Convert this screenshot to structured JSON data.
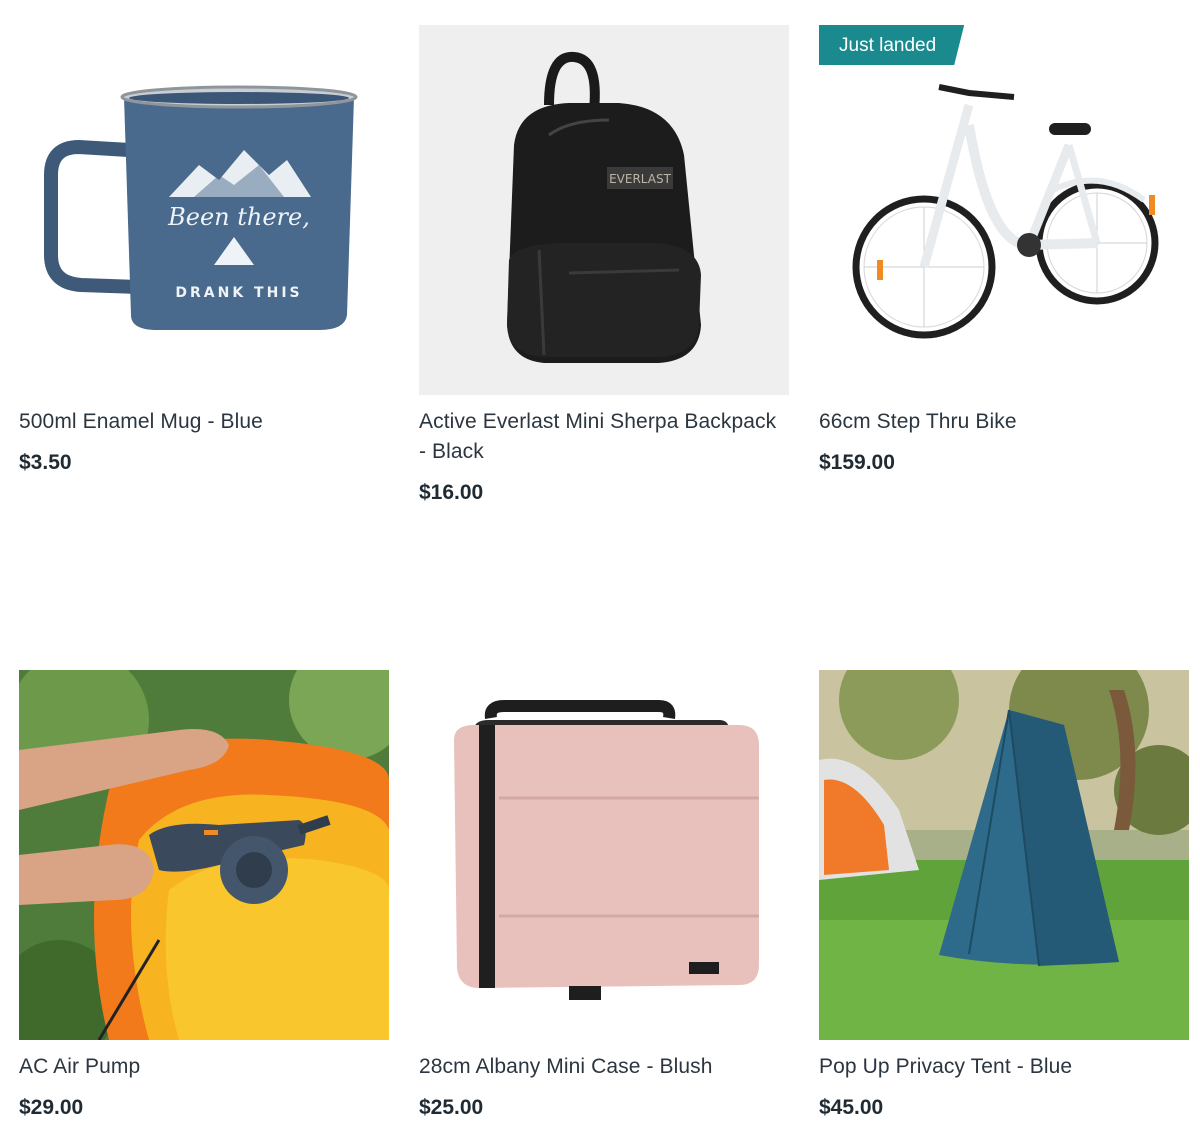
{
  "products": [
    {
      "title": "500ml Enamel Mug - Blue",
      "price": "$3.50",
      "image_icon": "enamel-mug-image"
    },
    {
      "title": "Active Everlast Mini Sherpa Backpack - Black",
      "price": "$16.00",
      "image_icon": "backpack-image",
      "brand_text": "EVERLAST"
    },
    {
      "title": "66cm Step Thru Bike",
      "price": "$159.00",
      "badge": "Just landed",
      "image_icon": "bike-image"
    },
    {
      "title": "AC Air Pump",
      "price": "$29.00",
      "image_icon": "air-pump-image"
    },
    {
      "title": "28cm Albany Mini Case - Blush",
      "price": "$25.00",
      "image_icon": "mini-case-image"
    },
    {
      "title": "Pop Up Privacy Tent - Blue",
      "price": "$45.00",
      "image_icon": "tent-image"
    }
  ],
  "mug_print": {
    "line1": "Been there,",
    "line2": "DRANK THIS"
  },
  "colors": {
    "badge": "#1b8a8f",
    "text": "#2b3640"
  }
}
